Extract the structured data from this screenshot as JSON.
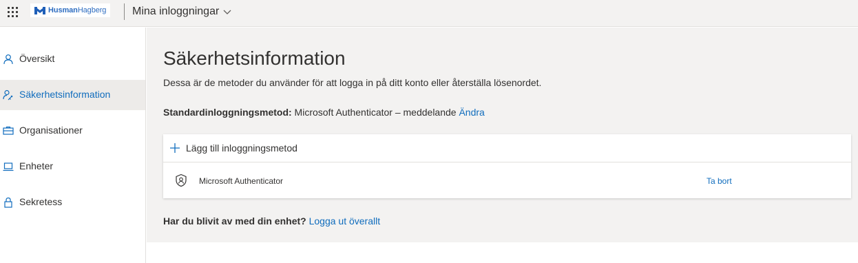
{
  "header": {
    "brand": {
      "part1": "Husman",
      "part2": "Hagberg"
    },
    "app_title": "Mina inloggningar"
  },
  "sidebar": {
    "items": [
      {
        "label": "Översikt",
        "icon": "person-icon",
        "active": false
      },
      {
        "label": "Säkerhetsinformation",
        "icon": "key-person-icon",
        "active": true
      },
      {
        "label": "Organisationer",
        "icon": "briefcase-icon",
        "active": false
      },
      {
        "label": "Enheter",
        "icon": "laptop-icon",
        "active": false
      },
      {
        "label": "Sekretess",
        "icon": "lock-icon",
        "active": false
      }
    ]
  },
  "main": {
    "title": "Säkerhetsinformation",
    "description": "Dessa är de metoder du använder för att logga in på ditt konto eller återställa lösenordet.",
    "default_method": {
      "label": "Standardinloggningsmetod:",
      "value": " Microsoft Authenticator – meddelande ",
      "change_link": "Ändra"
    },
    "add_method_label": "Lägg till inloggningsmetod",
    "methods": [
      {
        "name": "Microsoft Authenticator",
        "remove_label": "Ta bort"
      }
    ],
    "lost_device": {
      "question": "Har du blivit av med din enhet?",
      "link": "Logga ut överallt"
    }
  },
  "colors": {
    "accent": "#0f6cbd",
    "brand": "#2d6cc0",
    "background": "#f3f2f1"
  }
}
